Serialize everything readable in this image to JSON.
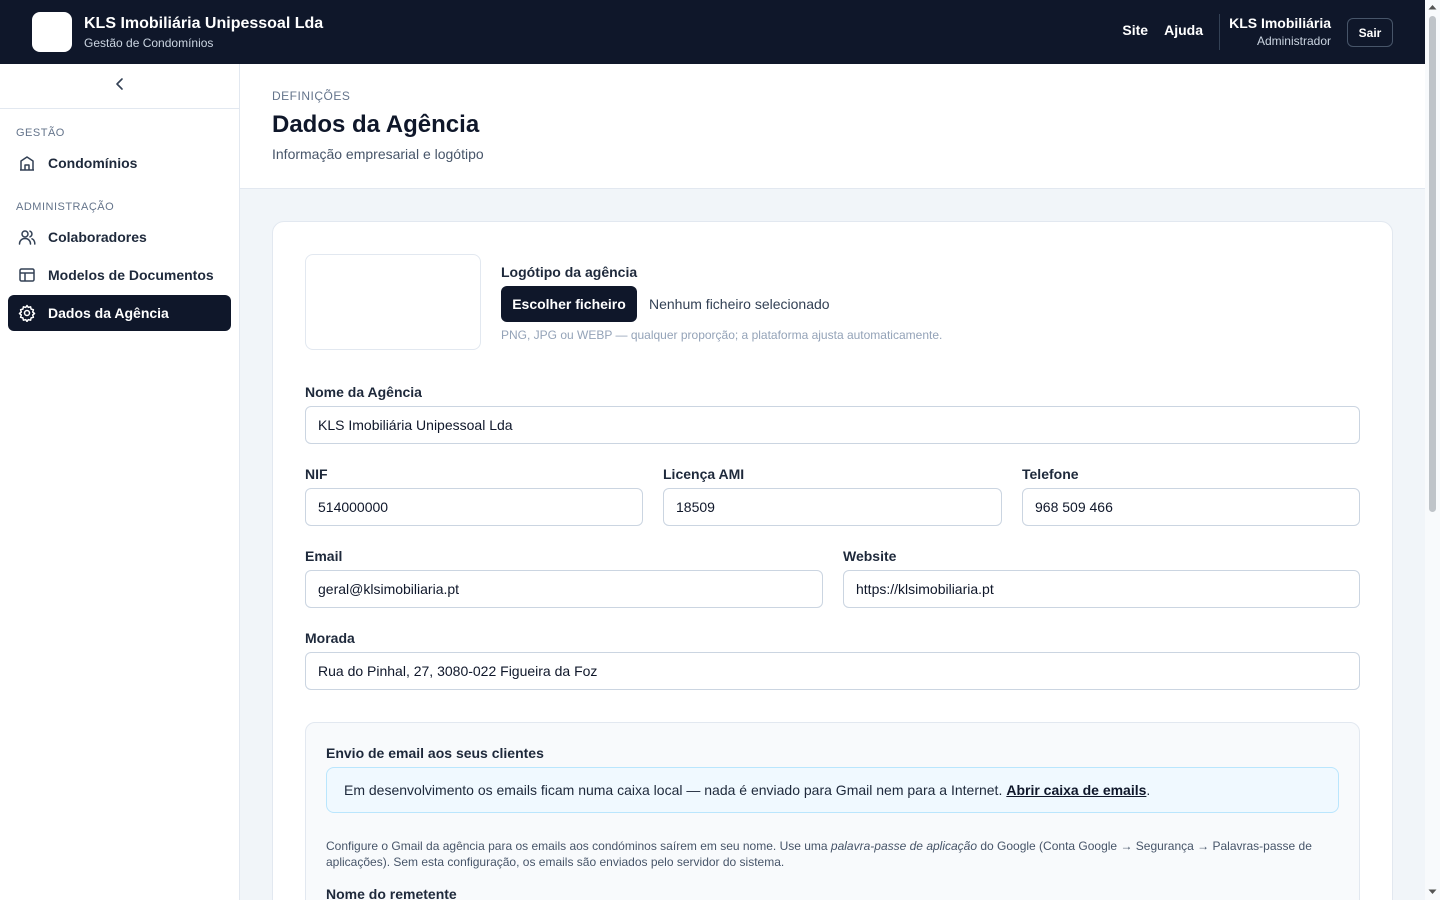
{
  "app": {
    "title": "KLS Imobiliária Unipessoal Lda",
    "subtitle": "Gestão de Condomínios"
  },
  "topnav": {
    "links": [
      "Site",
      "Ajuda"
    ],
    "user_name": "KLS Imobiliária",
    "user_role": "Administrador",
    "logout_label": "Sair"
  },
  "sidebar": {
    "sections": [
      {
        "label": "GESTÃO",
        "items": [
          {
            "label": "Condomínios",
            "icon": "building-icon"
          }
        ]
      },
      {
        "label": "ADMINISTRAÇÃO",
        "items": [
          {
            "label": "Colaboradores",
            "icon": "users-icon"
          },
          {
            "label": "Modelos de Documentos",
            "icon": "layout-icon"
          },
          {
            "label": "Dados da Agência",
            "icon": "gear-icon",
            "active": true
          }
        ]
      }
    ]
  },
  "header": {
    "breadcrumb": "DEFINIÇÕES",
    "title": "Dados da Agência",
    "subtitle": "Informação empresarial e logótipo"
  },
  "logo": {
    "label": "Logótipo da agência",
    "button": "Escolher ficheiro",
    "status": "Nenhum ficheiro selecionado",
    "hint": "PNG, JPG ou WEBP — qualquer proporção; a plataforma ajusta automaticamente."
  },
  "form": {
    "name": {
      "label": "Nome da Agência",
      "value": "KLS Imobiliária Unipessoal Lda"
    },
    "nif": {
      "label": "NIF",
      "value": "514000000"
    },
    "ami": {
      "label": "Licença AMI",
      "value": "18509"
    },
    "phone": {
      "label": "Telefone",
      "value": "968 509 466"
    },
    "email": {
      "label": "Email",
      "value": "geral@klsimobiliaria.pt"
    },
    "website": {
      "label": "Website",
      "value": "https://klsimobiliaria.pt"
    },
    "address": {
      "label": "Morada",
      "value": "Rua do Pinhal, 27, 3080-022 Figueira da Foz"
    }
  },
  "email_section": {
    "title": "Envio de email aos seus clientes",
    "notice_text": "Em desenvolvimento os emails ficam numa caixa local — nada é enviado para Gmail nem para a Internet.",
    "notice_link": "Abrir caixa de emails",
    "desc_part1": "Configure o Gmail da agência para os emails aos condóminos saírem em seu nome. Use uma ",
    "desc_italic": "palavra-passe de aplicação",
    "desc_part2": " do Google (Conta Google → Segurança → Palavras-passe de aplicações). Sem esta configuração, os emails são enviados pelo servidor do sistema.",
    "sender_label": "Nome do remetente"
  }
}
